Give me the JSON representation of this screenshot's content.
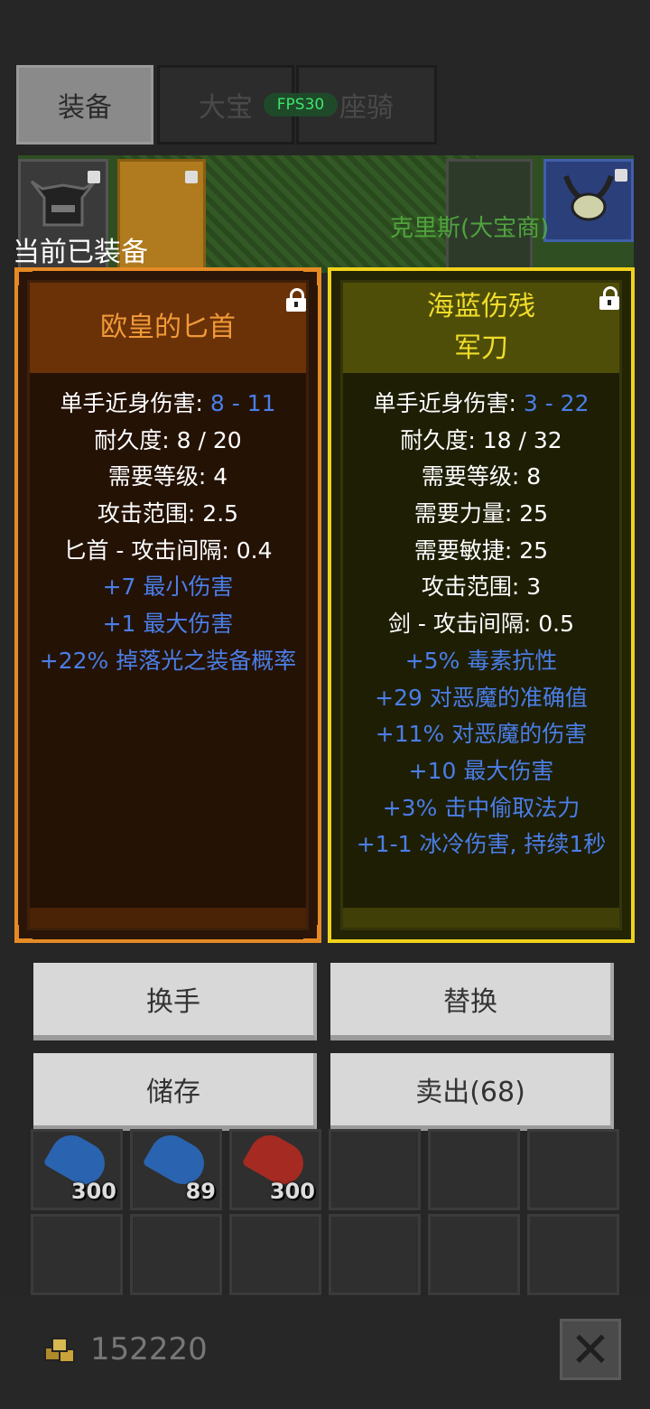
{
  "tabs": [
    {
      "label": "装备",
      "active": true
    },
    {
      "label": "大宝",
      "active": false
    },
    {
      "label": "座骑",
      "active": false
    }
  ],
  "fps_badge": "FPS30",
  "npc_name": "克里斯(大宝商)",
  "equipped_label": "当前已装备",
  "left_item": {
    "name_lines": [
      "欧皇的匕首"
    ],
    "color": "#f09a38",
    "stats": [
      {
        "label": "单手近身伤害: ",
        "value": "8 - 11"
      },
      {
        "label": "耐久度: 8 / 20"
      },
      {
        "label": "需要等级: 4"
      },
      {
        "label": "攻击范围: 2.5"
      },
      {
        "label": "匕首 - 攻击间隔: 0.4"
      },
      {
        "label": "+7 最小伤害",
        "bonus": true
      },
      {
        "label": "+1 最大伤害",
        "bonus": true
      },
      {
        "label": "+22% 掉落光之装备概率",
        "bonus": true
      }
    ]
  },
  "right_item": {
    "name_lines": [
      "海蓝伤残",
      "军刀"
    ],
    "color": "#f0dc2a",
    "stats": [
      {
        "label": "单手近身伤害: ",
        "value": "3 - 22"
      },
      {
        "label": "耐久度: 18 / 32"
      },
      {
        "label": "需要等级: 8"
      },
      {
        "label": "需要力量: 25"
      },
      {
        "label": "需要敏捷: 25"
      },
      {
        "label": "攻击范围: 3"
      },
      {
        "label": "剑 - 攻击间隔: 0.5"
      },
      {
        "label": "+5% 毒素抗性",
        "bonus": true
      },
      {
        "label": "+29 对恶魔的准确值",
        "bonus": true
      },
      {
        "label": "+11% 对恶魔的伤害",
        "bonus": true
      },
      {
        "label": "+10 最大伤害",
        "bonus": true
      },
      {
        "label": "+3% 击中偷取法力",
        "bonus": true
      },
      {
        "label": "+1-1 冰冷伤害, 持续1秒",
        "bonus": true
      }
    ]
  },
  "buttons": {
    "swap_hand": "换手",
    "replace": "替换",
    "store": "储存",
    "sell": "卖出(68)"
  },
  "inventory": [
    {
      "item": "blue-potion",
      "qty": "300"
    },
    {
      "item": "blue-potion",
      "qty": "89"
    },
    {
      "item": "red-potion",
      "qty": "300"
    }
  ],
  "gold": "152220",
  "colors": {
    "bonus_text": "#4a7ee6",
    "unique_orange": "#e58a25",
    "rare_yellow": "#f1d21b"
  }
}
